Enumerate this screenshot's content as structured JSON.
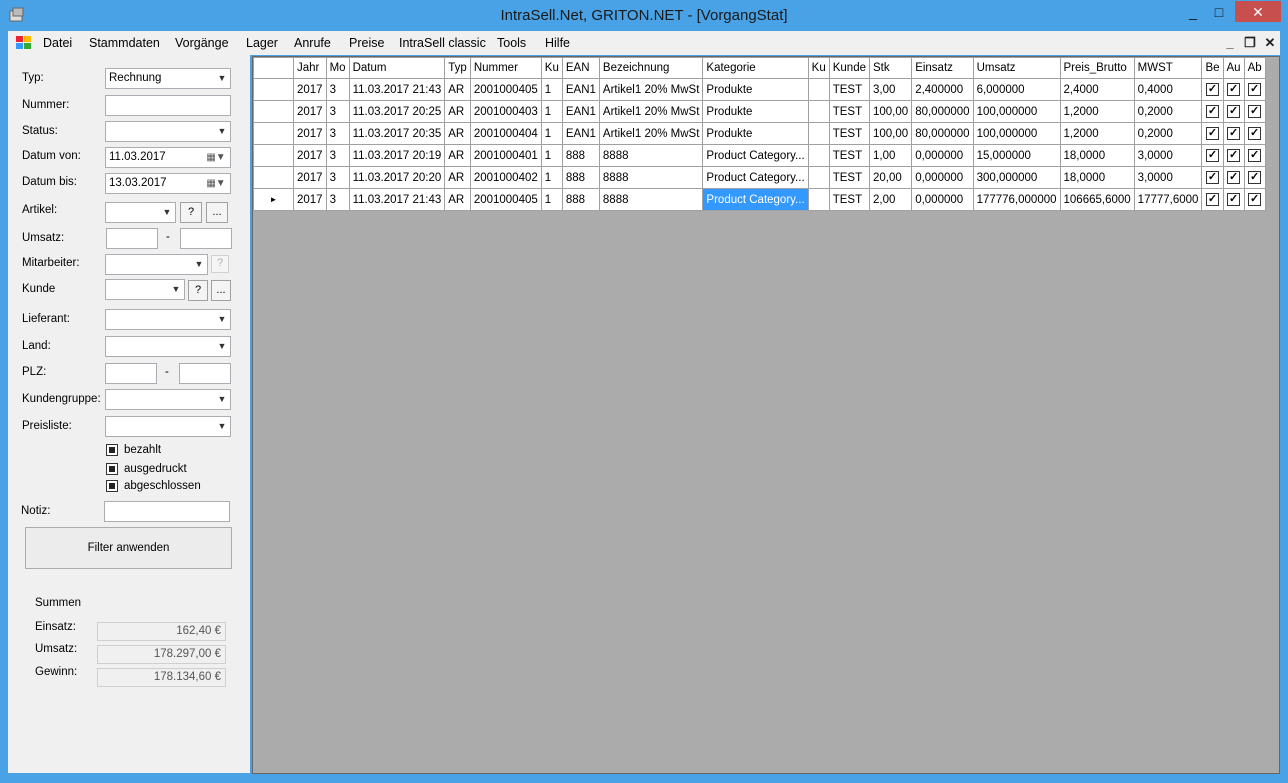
{
  "window": {
    "title": "IntraSell.Net, GRITON.NET - [VorgangStat]",
    "minimize": "_",
    "maximize": "□",
    "close": "✕"
  },
  "menu": [
    "Datei",
    "Stammdaten",
    "Vorgänge",
    "Lager",
    "Anrufe",
    "Preise",
    "IntraSell classic",
    "Tools",
    "Hilfe"
  ],
  "mdi": {
    "minimize": "_",
    "restore": "❐",
    "close": "✕"
  },
  "filters": {
    "typ_label": "Typ:",
    "typ_value": "Rechnung",
    "nummer_label": "Nummer:",
    "status_label": "Status:",
    "datum_von_label": "Datum von:",
    "datum_von_value": "11.03.2017",
    "datum_bis_label": "Datum bis:",
    "datum_bis_value": "13.03.2017",
    "artikel_label": "Artikel:",
    "umsatz_label": "Umsatz:",
    "range_sep": "-",
    "mitarbeiter_label": "Mitarbeiter:",
    "kunde_label": "Kunde",
    "lieferant_label": "Lieferant:",
    "land_label": "Land:",
    "plz_label": "PLZ:",
    "kundengruppe_label": "Kundengruppe:",
    "preisliste_label": "Preisliste:",
    "bezahlt": "bezahlt",
    "ausgedruckt": "ausgedruckt",
    "abgeschlossen": "abgeschlossen",
    "notiz_label": "Notiz:",
    "filter_button": "Filter anwenden",
    "help_button": "?",
    "browse_button": "..."
  },
  "summen": {
    "title": "Summen",
    "einsatz_label": "Einsatz:",
    "einsatz_value": "162,40 €",
    "umsatz_label": "Umsatz:",
    "umsatz_value": "178.297,00 €",
    "gewinn_label": "Gewinn:",
    "gewinn_value": "178.134,60 €"
  },
  "grid": {
    "columns": [
      "Jahr",
      "Mo",
      "Datum",
      "Typ",
      "Nummer",
      "Ku",
      "EAN",
      "Bezeichnung",
      "Kategorie",
      "Ku",
      "Kunde",
      "Stk",
      "Einsatz",
      "Umsatz",
      "Preis_Brutto",
      "MWST",
      "Be",
      "Au",
      "Ab"
    ],
    "rows": [
      [
        "2017",
        "3",
        "11.03.2017 21:43",
        "AR",
        "2001000405",
        "1",
        "EAN1",
        "Artikel1 20% MwSt",
        "Produkte",
        "",
        "TEST",
        "3,00",
        "2,400000",
        "6,000000",
        "2,4000",
        "0,4000"
      ],
      [
        "2017",
        "3",
        "11.03.2017 20:25",
        "AR",
        "2001000403",
        "1",
        "EAN1",
        "Artikel1 20% MwSt",
        "Produkte",
        "",
        "TEST",
        "100,00",
        "80,000000",
        "100,000000",
        "1,2000",
        "0,2000"
      ],
      [
        "2017",
        "3",
        "11.03.2017 20:35",
        "AR",
        "2001000404",
        "1",
        "EAN1",
        "Artikel1 20% MwSt",
        "Produkte",
        "",
        "TEST",
        "100,00",
        "80,000000",
        "100,000000",
        "1,2000",
        "0,2000"
      ],
      [
        "2017",
        "3",
        "11.03.2017 20:19",
        "AR",
        "2001000401",
        "1",
        "888",
        "8888",
        "Product Category...",
        "",
        "TEST",
        "1,00",
        "0,000000",
        "15,000000",
        "18,0000",
        "3,0000"
      ],
      [
        "2017",
        "3",
        "11.03.2017 20:20",
        "AR",
        "2001000402",
        "1",
        "888",
        "8888",
        "Product Category...",
        "",
        "TEST",
        "20,00",
        "0,000000",
        "300,000000",
        "18,0000",
        "3,0000"
      ],
      [
        "2017",
        "3",
        "11.03.2017 21:43",
        "AR",
        "2001000405",
        "1",
        "888",
        "8888",
        "Product Category...",
        "",
        "TEST",
        "2,00",
        "0,000000",
        "177776,000000",
        "106665,6000",
        "17777,6000"
      ]
    ],
    "checked": "✓",
    "current_row_marker": "►"
  }
}
